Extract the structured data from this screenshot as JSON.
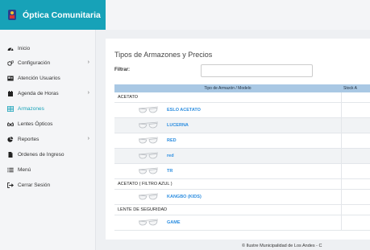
{
  "app": {
    "title": "Óptica Comunitaria"
  },
  "sidebar": {
    "items": [
      {
        "label": "Inicio",
        "icon": "dashboard-icon",
        "has_submenu": false,
        "active": false
      },
      {
        "label": "Configuración",
        "icon": "gears-icon",
        "has_submenu": true,
        "active": false
      },
      {
        "label": "Atención Usuarios",
        "icon": "contact-card-icon",
        "has_submenu": false,
        "active": false
      },
      {
        "label": "Agenda de Horas",
        "icon": "calendar-icon",
        "has_submenu": true,
        "active": false
      },
      {
        "label": "Armazones",
        "icon": "grid-icon",
        "has_submenu": false,
        "active": true
      },
      {
        "label": "Lentes Ópticos",
        "icon": "glasses-icon",
        "has_submenu": false,
        "active": false
      },
      {
        "label": "Reportes",
        "icon": "pie-chart-icon",
        "has_submenu": true,
        "active": false
      },
      {
        "label": "Ordenes de Ingreso",
        "icon": "document-icon",
        "has_submenu": false,
        "active": false
      },
      {
        "label": "Menú",
        "icon": "list-icon",
        "has_submenu": false,
        "active": false
      },
      {
        "label": "Cerrar Sesión",
        "icon": "sign-out-icon",
        "has_submenu": false,
        "active": false
      }
    ]
  },
  "main": {
    "title": "Tipos de Armazones y Precios",
    "filter": {
      "label": "Filtrar:",
      "value": "",
      "placeholder": ""
    },
    "table": {
      "columns": [
        "Tipo de Armazón / Modelo",
        "Stock A"
      ],
      "rows": [
        {
          "type": "group",
          "label": "ACETATO"
        },
        {
          "type": "item",
          "label": "ESLO ACETATO"
        },
        {
          "type": "item",
          "label": "LUCERNA"
        },
        {
          "type": "item",
          "label": "RED"
        },
        {
          "type": "item",
          "label": "red"
        },
        {
          "type": "item",
          "label": "TR"
        },
        {
          "type": "group",
          "label": "ACETATO ( FILTRO AZUL )"
        },
        {
          "type": "item",
          "label": "KANGBO (KIDS)"
        },
        {
          "type": "group",
          "label": "LENTE DE SEGURIDAD"
        },
        {
          "type": "item",
          "label": "GAME"
        }
      ]
    }
  },
  "footer": {
    "text": "© Ilustre Municipalidad de Los Andes - C"
  },
  "colors": {
    "brand": "#17a2b8",
    "link": "#2d8ee0",
    "table_header": "#a9c8e4"
  }
}
